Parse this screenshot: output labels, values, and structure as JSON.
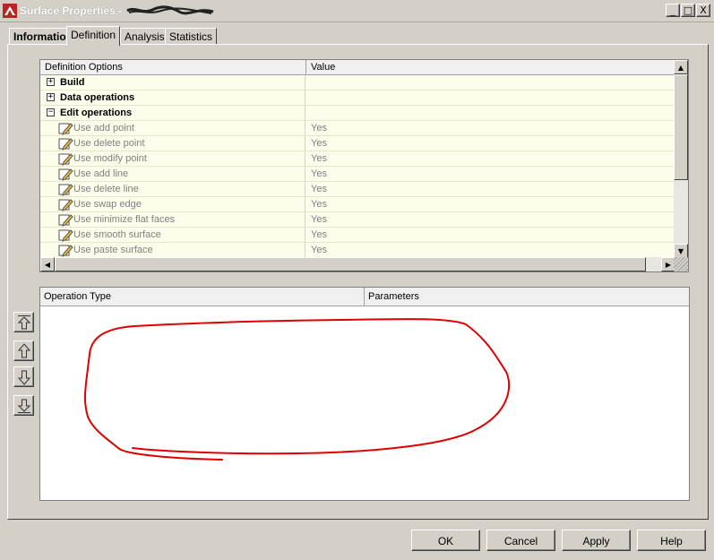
{
  "window": {
    "title": "Surface Properties - ",
    "minimize_glyph": "_",
    "maximize_glyph": "□",
    "close_glyph": "X"
  },
  "tabs": [
    {
      "label": "Information",
      "active": false
    },
    {
      "label": "Definition",
      "active": true
    },
    {
      "label": "Analysis",
      "active": false
    },
    {
      "label": "Statistics",
      "active": false
    }
  ],
  "definition_grid": {
    "columns": [
      "Definition Options",
      "Value"
    ],
    "groups": [
      {
        "label": "Build",
        "expanded": false,
        "expander": "+"
      },
      {
        "label": "Data operations",
        "expanded": false,
        "expander": "+"
      },
      {
        "label": "Edit operations",
        "expanded": true,
        "expander": "−"
      }
    ],
    "items": [
      {
        "label": "Use add point",
        "value": "Yes"
      },
      {
        "label": "Use delete point",
        "value": "Yes"
      },
      {
        "label": "Use modify point",
        "value": "Yes"
      },
      {
        "label": "Use add line",
        "value": "Yes"
      },
      {
        "label": "Use delete line",
        "value": "Yes"
      },
      {
        "label": "Use swap edge",
        "value": "Yes"
      },
      {
        "label": "Use minimize flat faces",
        "value": "Yes"
      },
      {
        "label": "Use smooth surface",
        "value": "Yes"
      },
      {
        "label": "Use paste surface",
        "value": "Yes"
      }
    ]
  },
  "operations_list": {
    "columns": [
      "Operation Type",
      "Parameters"
    ]
  },
  "side_buttons": [
    "move-to-top",
    "move-up",
    "move-down",
    "move-to-bottom"
  ],
  "buttons": {
    "ok": "OK",
    "cancel": "Cancel",
    "apply": "Apply",
    "help": "Help"
  },
  "colors": {
    "dialog_bg": "#d4d0c8",
    "row_bg": "#fdfdec",
    "annotation": "#e00000"
  }
}
